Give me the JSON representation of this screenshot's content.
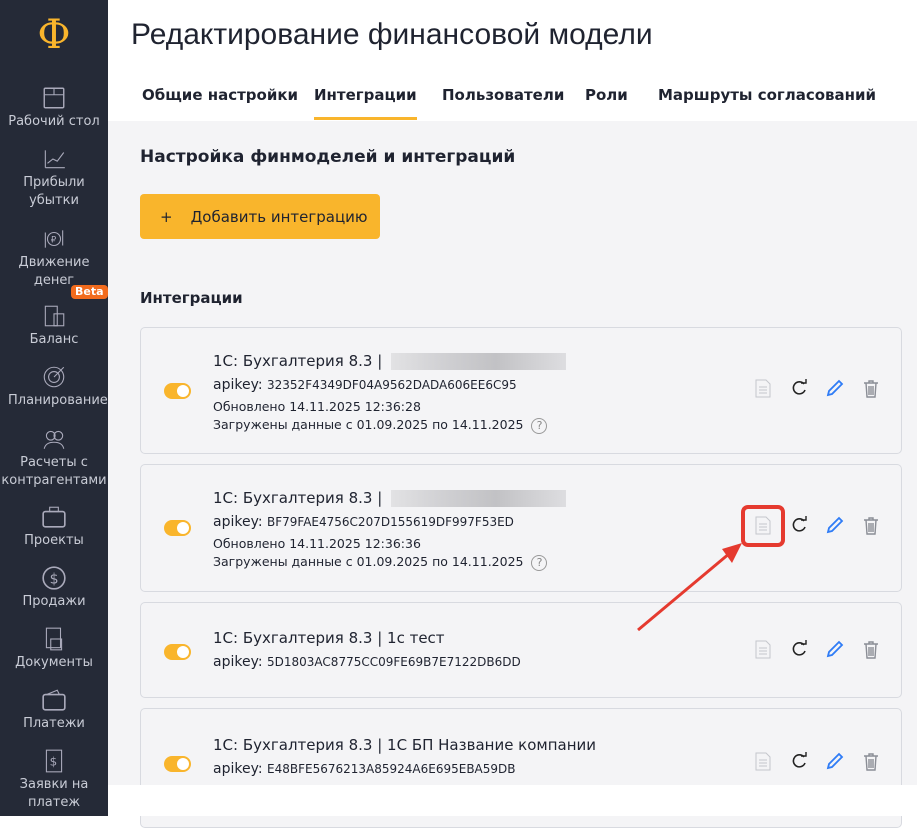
{
  "sidebar": {
    "logo": "Ф",
    "items": [
      {
        "label": "Рабочий стол",
        "icon": "dashboard-icon"
      },
      {
        "label": "Прибыли убытки",
        "icon": "chart-icon"
      },
      {
        "label": "Движение денег",
        "icon": "cashflow-icon"
      },
      {
        "label": "Баланс",
        "icon": "balance-icon",
        "badge": "Beta"
      },
      {
        "label": "Планирование",
        "icon": "target-icon"
      },
      {
        "label": "Расчеты с контрагентами",
        "icon": "people-icon"
      },
      {
        "label": "Проекты",
        "icon": "briefcase-icon"
      },
      {
        "label": "Продажи",
        "icon": "dollar-icon"
      },
      {
        "label": "Документы",
        "icon": "documents-icon"
      },
      {
        "label": "Платежи",
        "icon": "wallet-icon"
      },
      {
        "label": "Заявки на платеж",
        "icon": "invoice-icon"
      }
    ]
  },
  "header": {
    "title": "Редактирование финансовой модели",
    "tabs": [
      "Общие настройки",
      "Интеграции",
      "Пользователи",
      "Роли",
      "Маршруты согласований"
    ],
    "active_tab": 1
  },
  "main": {
    "heading": "Настройка финмоделей и интеграций",
    "add_button": "Добавить интеграцию",
    "add_icon": "+",
    "list_heading": "Интеграции",
    "integrations": [
      {
        "name": "1С: Бухгалтерия 8.3 |",
        "suffix": "",
        "apikey_label": "apikey:",
        "apikey": "32352F4349DF04A9562DADA606EE6C95",
        "updated": "Обновлено 14.11.2025 12:36:28",
        "loaded": "Загружены данные с 01.09.2025 по 14.11.2025",
        "enabled": true
      },
      {
        "name": "1С: Бухгалтерия 8.3 |",
        "suffix": "",
        "apikey_label": "apikey:",
        "apikey": "BF79FAE4756C207D155619DF997F53ED",
        "updated": "Обновлено 14.11.2025 12:36:36",
        "loaded": "Загружены данные с 01.09.2025 по 14.11.2025",
        "enabled": true
      },
      {
        "name": "1С: Бухгалтерия 8.3 |",
        "suffix": "1с тест",
        "apikey_label": "apikey:",
        "apikey": "5D1803AC8775CC09FE69B7E7122DB6DD",
        "enabled": true
      },
      {
        "name": "1С: Бухгалтерия 8.3 |",
        "suffix": "1С БП Название компании",
        "apikey_label": "apikey:",
        "apikey": "E48BFE5676213A85924A6E695EBA59DB",
        "enabled": true
      }
    ]
  },
  "colors": {
    "accent": "#f9b52c",
    "sidebar": "#252a37",
    "highlight": "#e53a2f",
    "edit": "#2f7cf6"
  }
}
